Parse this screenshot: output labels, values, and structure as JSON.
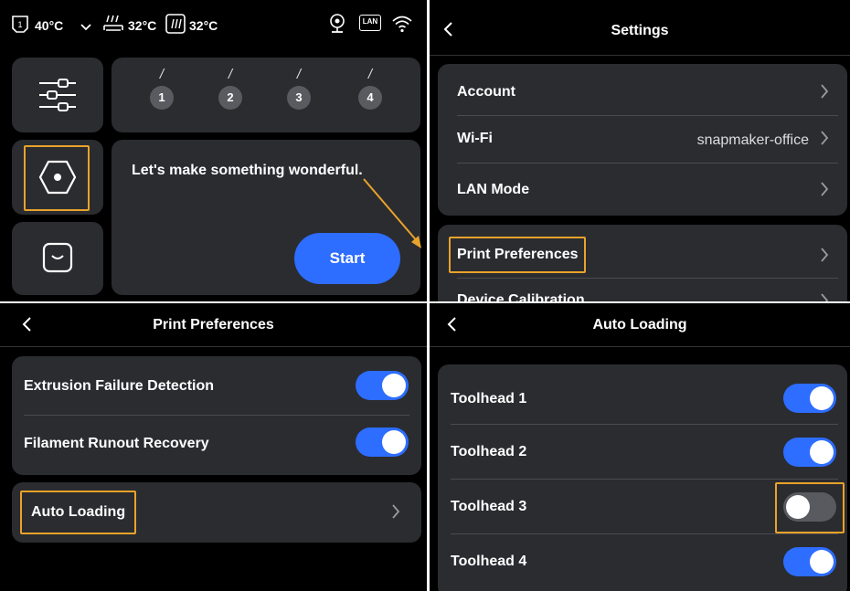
{
  "home": {
    "status": {
      "toolhead_temp": "40°C",
      "bed_temp": "32°C",
      "chamber_temp": "32°C",
      "lan_badge": "LAN",
      "icons": [
        "toolhead-icon",
        "chevron-down-icon",
        "bed-heat-icon",
        "chamber-heat-icon",
        "camera-icon",
        "lan-icon",
        "wifi-icon"
      ]
    },
    "slots": [
      {
        "slash": "/",
        "number": "1"
      },
      {
        "slash": "/",
        "number": "2"
      },
      {
        "slash": "/",
        "number": "3"
      },
      {
        "slash": "/",
        "number": "4"
      }
    ],
    "message": "Let's make something wonderful.",
    "start_label": "Start",
    "side_icons": [
      "sliders-icon",
      "hexagon-icon",
      "tray-icon"
    ]
  },
  "settings": {
    "title": "Settings",
    "rows": [
      {
        "label": "Account",
        "value": ""
      },
      {
        "label": "Wi-Fi",
        "value": "snapmaker-office"
      },
      {
        "label": "LAN Mode",
        "value": ""
      }
    ],
    "rows2": [
      {
        "label": "Print Preferences"
      },
      {
        "label": "Device Calibration"
      }
    ]
  },
  "print_prefs": {
    "title": "Print Preferences",
    "toggles": [
      {
        "label": "Extrusion Failure Detection",
        "on": true
      },
      {
        "label": "Filament Runout Recovery",
        "on": true
      }
    ],
    "auto_loading_label": "Auto Loading"
  },
  "auto_loading": {
    "title": "Auto Loading",
    "toolheads": [
      {
        "label": "Toolhead 1",
        "on": true
      },
      {
        "label": "Toolhead 2",
        "on": true
      },
      {
        "label": "Toolhead 3",
        "on": false
      },
      {
        "label": "Toolhead 4",
        "on": true
      }
    ]
  },
  "colors": {
    "accent": "#2d6dff",
    "highlight": "#e8a32a",
    "card": "#2b2c30",
    "toggle_off": "#595a5f"
  }
}
